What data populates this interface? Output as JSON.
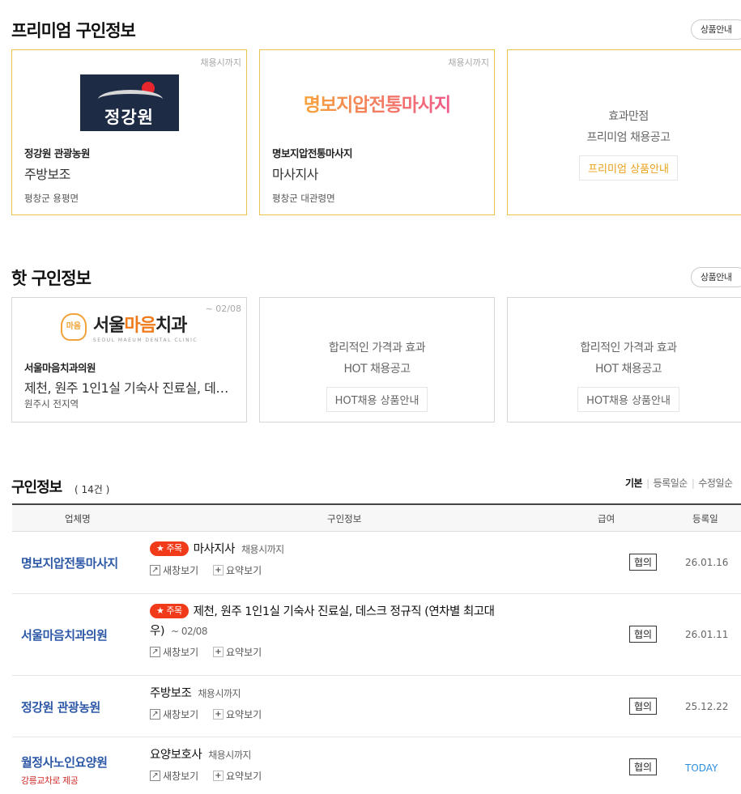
{
  "premium": {
    "title": "프리미엄 구인정보",
    "info_button": "상품안내",
    "cards": [
      {
        "period": "채용시까지",
        "logo_text": "정강원",
        "company": "정강원 관광농원",
        "job": "주방보조",
        "location": "평창군 용평면"
      },
      {
        "period": "채용시까지",
        "logo_text": "명보지압전통마사지",
        "company": "명보지압전통마사지",
        "job": "마사지사",
        "location": "평창군 대관령면"
      }
    ],
    "promo": {
      "line1": "효과만점",
      "line2": "프리미엄 채용공고",
      "button": "프리미엄 상품안내"
    }
  },
  "hot": {
    "title": "핫 구인정보",
    "info_button": "상품안내",
    "cards": [
      {
        "period": "~ 02/08",
        "logo_mark": "마음",
        "logo_name_a": "서울",
        "logo_name_b": "마음",
        "logo_name_c": "치과",
        "logo_sub": "SEOUL MAEUM DENTAL CLINIC",
        "company": "서울마음치과의원",
        "job": "제천, 원주 1인1실 기숙사 진료실, 데스크 정규직 (연차별 최고대우)",
        "location": "원주시 전지역"
      }
    ],
    "promos": [
      {
        "line1": "합리적인 가격과 효과",
        "line2": "HOT 채용공고",
        "button": "HOT채용 상품안내"
      },
      {
        "line1": "합리적인 가격과 효과",
        "line2": "HOT 채용공고",
        "button": "HOT채용 상품안내"
      }
    ]
  },
  "list": {
    "title": "구인정보",
    "count": "( 14건 )",
    "sort": {
      "basic": "기본",
      "registered": "등록일순",
      "modified": "수정일순"
    },
    "headers": {
      "company": "업체명",
      "info": "구인정보",
      "pay": "급여",
      "date": "등록일"
    },
    "new_window": "새창보기",
    "summary": "요약보기",
    "badge": "주목",
    "rows": [
      {
        "company": "명보지압전통마사지",
        "sub": "",
        "title": "마사지사",
        "period": "채용시까지",
        "pay": "협의",
        "date": "26.01.16"
      },
      {
        "company": "서울마음치과의원",
        "sub": "",
        "title": "제천, 원주 1인1실 기숙사 진료실, 데스크 정규직 (연차별 최고대우)",
        "period": "~ 02/08",
        "pay": "협의",
        "date": "26.01.11"
      },
      {
        "company": "정강원 관광농원",
        "sub": "",
        "title": "주방보조",
        "period": "채용시까지",
        "pay": "협의",
        "date": "25.12.22"
      },
      {
        "company": "월정사노인요양원",
        "sub": "강릉교차로 제공",
        "title": "요양보호사",
        "period": "채용시까지",
        "pay": "협의",
        "date": "TODAY"
      }
    ]
  }
}
